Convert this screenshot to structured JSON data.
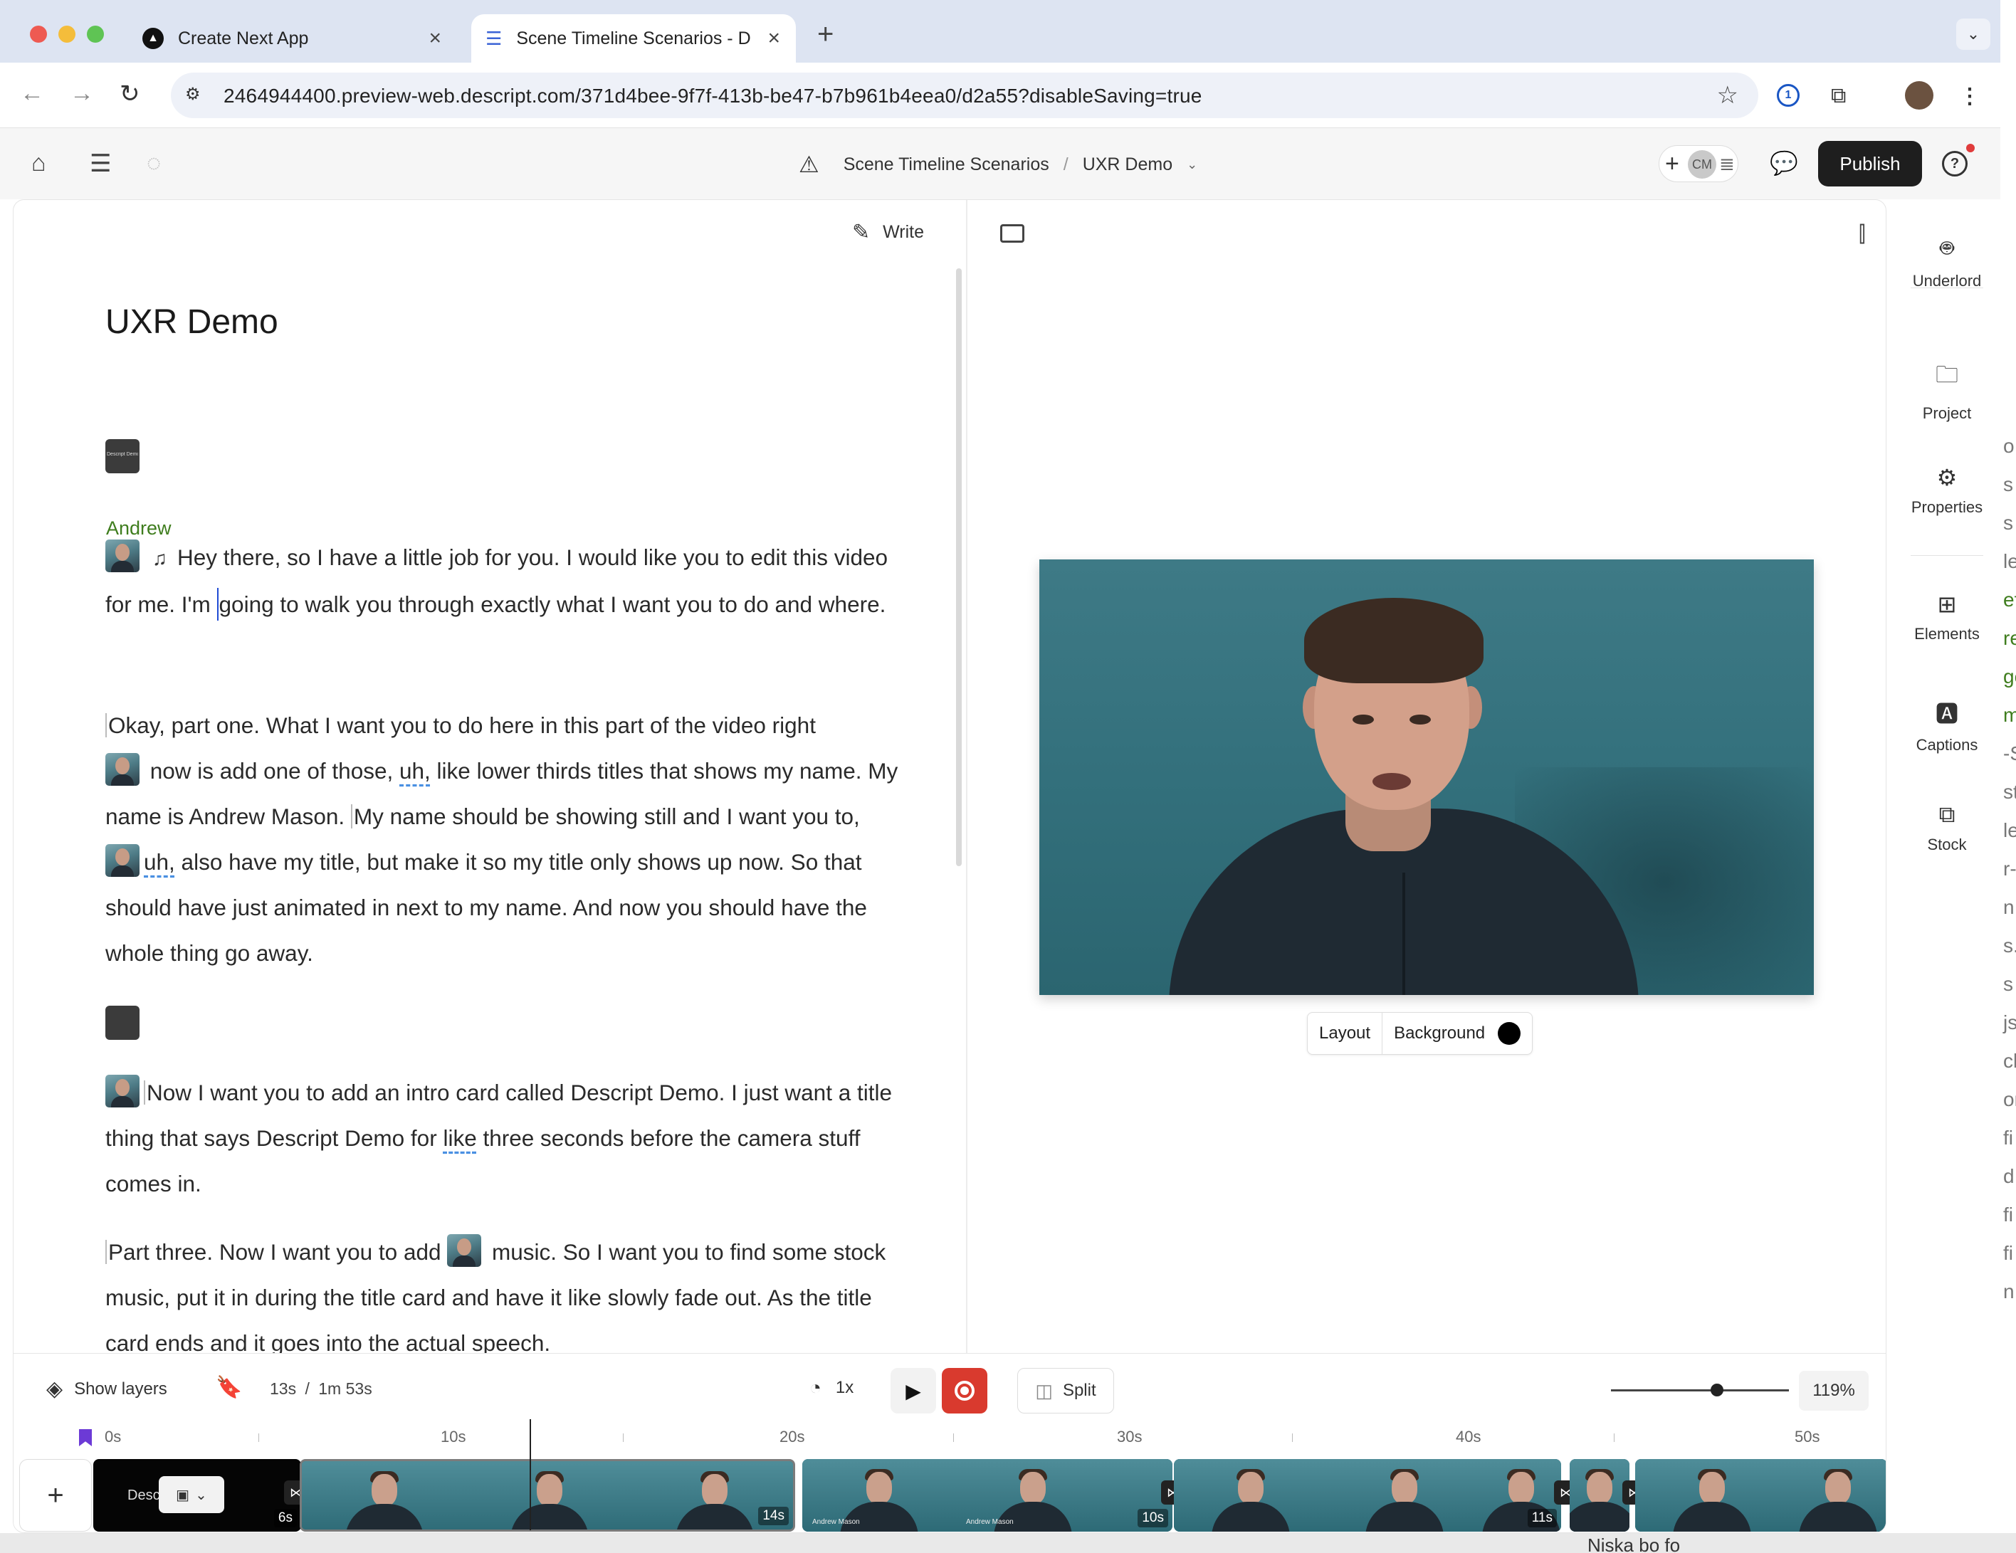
{
  "browser": {
    "tabs": [
      {
        "title": "Create Next App"
      },
      {
        "title": "Scene Timeline Scenarios - D"
      }
    ],
    "url": "2464944400.preview-web.descript.com/371d4bee-9f7f-413b-be47-b7b961b4eea0/d2a55?disableSaving=true"
  },
  "header": {
    "project": "Scene Timeline Scenarios",
    "separator": "/",
    "composition": "UXR Demo",
    "collaborator_initials": "CM",
    "publish_label": "Publish",
    "help_label": "?"
  },
  "script": {
    "write_label": "Write",
    "title": "UXR Demo",
    "title_card_text": "Descript Demo",
    "speaker": "Andrew",
    "para1": {
      "a": "Hey there, so I have a little job for you. I would like you to edit this video for me. I'm ",
      "b": "going to walk you through exactly what I want you to do and where."
    },
    "para2": {
      "a": "Okay, part one. What I want you to do here in this part of the video right",
      "b": " now is add one of those, ",
      "filler1": "uh,",
      "c": " like lower thirds titles that shows my name. My name is Andrew Mason. ",
      "d": "My name should be showing still and I want you to, ",
      "filler2": "uh,",
      "e": " also have my title, but make it so my title only shows up now. So that should have just animated in next to my name. And now you should have the whole thing go away."
    },
    "para3": {
      "a": "Now I want you to add an intro card called Descript Demo. I just want a title thing that says Descript Demo for ",
      "filler": "like",
      "b": " three seconds before the camera stuff comes in."
    },
    "para4": {
      "a": "Part three. Now I want you to add ",
      "b": " music. So I want you to find some stock music, put it in during the title card and have it like slowly fade out. As the title card ends and it goes into the actual speech."
    }
  },
  "preview": {
    "layout_label": "Layout",
    "background_label": "Background",
    "background_color": "#000000"
  },
  "timeline": {
    "show_layers_label": "Show layers",
    "current_time": "13s",
    "time_sep": "/",
    "total_time": "1m 53s",
    "speed": "1x",
    "split_label": "Split",
    "zoom": "119%",
    "ruler": [
      "0s",
      "10s",
      "20s",
      "30s",
      "40s",
      "50s"
    ],
    "title_clip_text": "Desc",
    "clip_durations": [
      "6s",
      "14s",
      "10s",
      "11s"
    ],
    "lower_third_text": "Andrew Mason"
  },
  "sidebar": {
    "items": [
      {
        "label": "Underlord",
        "icon": "robot-icon"
      },
      {
        "label": "Project",
        "icon": "folder-icon"
      },
      {
        "label": "Properties",
        "icon": "gear-icon"
      },
      {
        "label": "Elements",
        "icon": "shapes-icon"
      },
      {
        "label": "Captions",
        "icon": "captions-icon"
      },
      {
        "label": "Stock",
        "icon": "stock-media-icon"
      }
    ]
  },
  "background_window": {
    "right_edge_chars": [
      "o",
      "s",
      "s",
      "le",
      "ef",
      "re",
      "ge",
      "m",
      "-S",
      "st",
      "le",
      "r-",
      "n",
      "s.",
      "s",
      "js",
      "ck",
      "on",
      "fi",
      "d",
      "fi",
      "fi",
      "n"
    ],
    "bottom_text": "Niska bo fo"
  },
  "colors": {
    "accent_blue": "#1f4bd4",
    "record_red": "#d93a2e",
    "speaker_green": "#3f7d1e",
    "marker_purple": "#6c3ad6"
  }
}
